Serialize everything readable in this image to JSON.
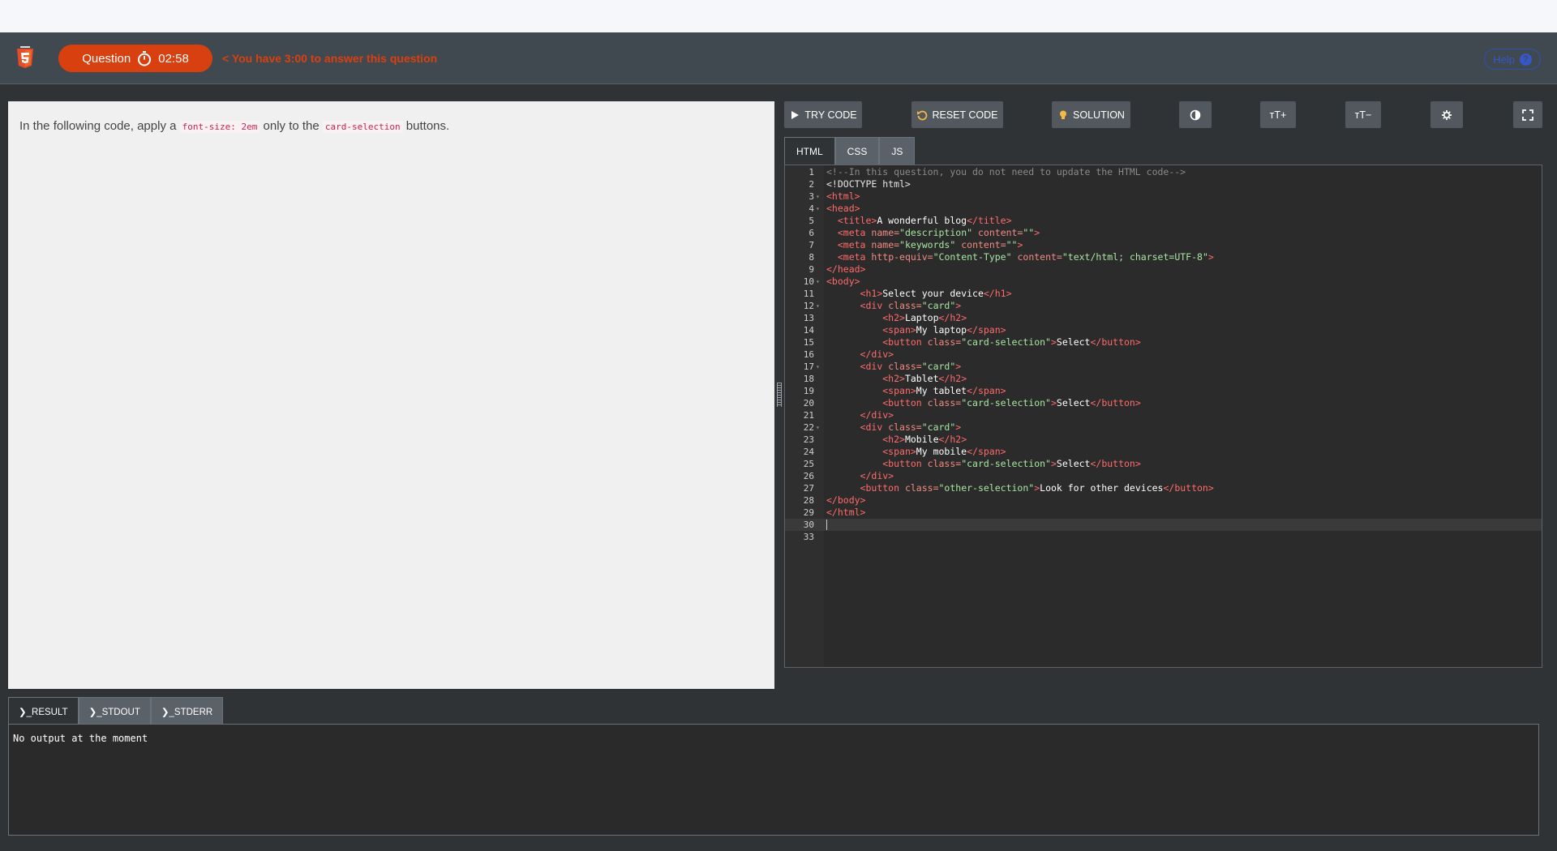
{
  "header": {
    "question_label": "Question",
    "timer": "02:58",
    "time_note": "< You have 3:00 to answer this question",
    "help_label": "Help",
    "help_icon": "?"
  },
  "instruction": {
    "part1": "In the following code, apply a ",
    "code1": "font-size: 2em",
    "part2": " only to the ",
    "code2": "card-selection",
    "part3": " buttons."
  },
  "toolbar": {
    "try_code": "TRY CODE",
    "reset_code": "RESET CODE",
    "solution": "SOLUTION",
    "font_up": "ᴛT+",
    "font_down": "ᴛT−"
  },
  "editor_tabs": [
    "HTML",
    "CSS",
    "JS"
  ],
  "code": {
    "line_numbers": [
      "1",
      "2",
      "3",
      "4",
      "5",
      "6",
      "7",
      "8",
      "9",
      "10",
      "11",
      "12",
      "13",
      "14",
      "15",
      "16",
      "17",
      "18",
      "19",
      "20",
      "21",
      "22",
      "23",
      "24",
      "25",
      "26",
      "27",
      "28",
      "29",
      "30",
      "33"
    ]
  },
  "output_tabs": [
    "❯_RESULT",
    "❯_STDOUT",
    "❯_STDERR"
  ],
  "output": {
    "text": "No output at the moment"
  },
  "colors": {
    "accent": "#d9400f",
    "help": "#3657c8"
  }
}
